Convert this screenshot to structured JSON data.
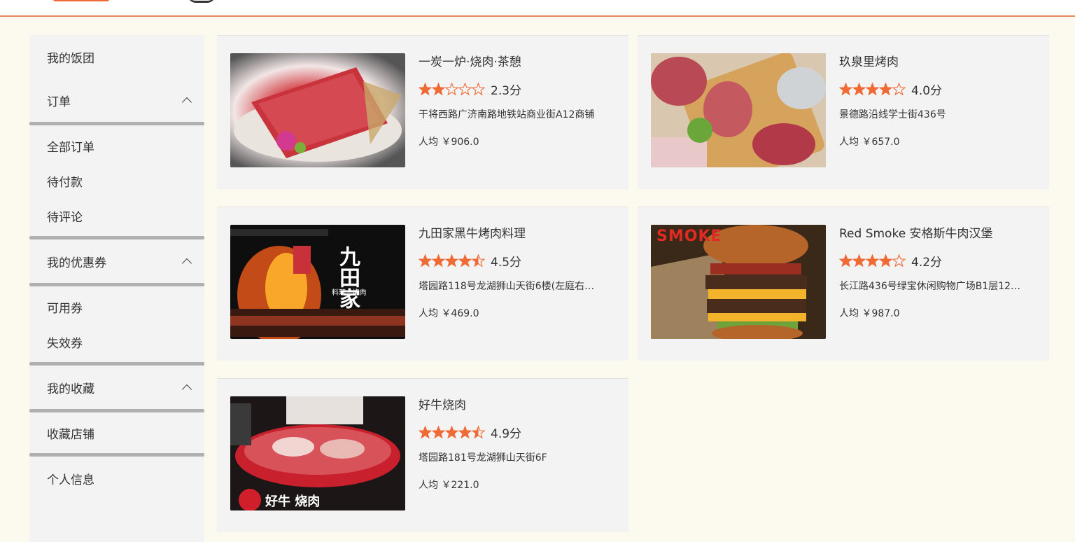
{
  "sidebar": {
    "my_groups": "我的饭团",
    "orders": {
      "label": "订单",
      "items": [
        "全部订单",
        "待付款",
        "待评论"
      ]
    },
    "coupons": {
      "label": "我的优惠券",
      "items": [
        "可用券",
        "失效券"
      ]
    },
    "favorites": {
      "label": "我的收藏",
      "items": [
        "收藏店铺"
      ]
    },
    "profile": "个人信息"
  },
  "restaurants": [
    {
      "name": "一炭一炉·烧肉·茶憩",
      "rating": 2.3,
      "score": "2.3分",
      "address": "干将西路广济南路地铁站商业街A12商铺",
      "price": "人均 ￥906.0",
      "image": "wagyu-plate"
    },
    {
      "name": "玖泉里烤肉",
      "rating": 4.0,
      "score": "4.0分",
      "address": "景德路沿线学士街436号",
      "price": "人均 ￥657.0",
      "image": "meat-board"
    },
    {
      "name": "九田家黑牛烤肉料理",
      "rating": 4.5,
      "score": "4.5分",
      "address": "塔园路118号龙湖狮山天街6楼(左庭右…",
      "price": "人均 ￥469.0",
      "image": "grill-fire"
    },
    {
      "name": "Red Smoke 安格斯牛肉汉堡",
      "rating": 4.2,
      "score": "4.2分",
      "address": "长江路436号绿宝休闲购物广场B1层12…",
      "price": "人均 ￥987.0",
      "image": "burger"
    },
    {
      "name": "好牛烧肉",
      "rating": 4.9,
      "score": "4.9分",
      "address": "塔园路181号龙湖狮山天街6F",
      "price": "人均 ￥221.0",
      "image": "meat-platter"
    }
  ],
  "thumb_text": {
    "jiutian_logo": "九田家",
    "jiutian_sub": "料理 · 烤肉",
    "smoke": "SMOKE",
    "haoniu_logo": "好牛 烧肉"
  },
  "colors": {
    "accent": "#f06a35",
    "star": "#f06a35",
    "card_bg": "#f3f3f3",
    "page_bg": "#fcf9ef"
  }
}
